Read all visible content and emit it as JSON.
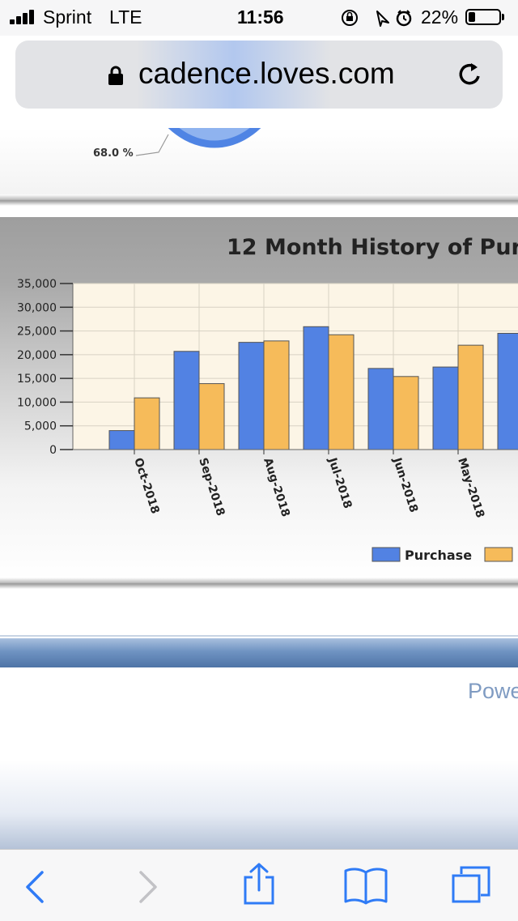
{
  "status": {
    "carrier": "Sprint",
    "network": "LTE",
    "time": "11:56",
    "battery_pct": "22%",
    "battery_level": 0.22
  },
  "browser": {
    "url": "cadence.loves.com"
  },
  "pie": {
    "label": "68.0 %"
  },
  "footer": {
    "powered_text": "Powe"
  },
  "chart_data": {
    "type": "bar",
    "title": "12 Month History of Purc",
    "categories": [
      "Oct-2018",
      "Sep-2018",
      "Aug-2018",
      "Jul-2018",
      "Jun-2018",
      "May-2018",
      ""
    ],
    "series": [
      {
        "name": "Purchase",
        "color": "#5282e3",
        "values": [
          4000,
          20700,
          22600,
          25900,
          17100,
          17400,
          24500
        ]
      },
      {
        "name": "",
        "color": "#f6bb5a",
        "values": [
          10900,
          13900,
          22900,
          24200,
          15400,
          22000,
          null
        ]
      }
    ],
    "ylim": [
      0,
      35000
    ],
    "yticks": [
      "0",
      "5,000",
      "10,000",
      "15,000",
      "20,000",
      "25,000",
      "30,000",
      "35,000"
    ],
    "ytick_values": [
      0,
      5000,
      10000,
      15000,
      20000,
      25000,
      30000,
      35000
    ],
    "xlabel": "",
    "ylabel": "",
    "grid": true,
    "legend_position": "bottom-right"
  }
}
